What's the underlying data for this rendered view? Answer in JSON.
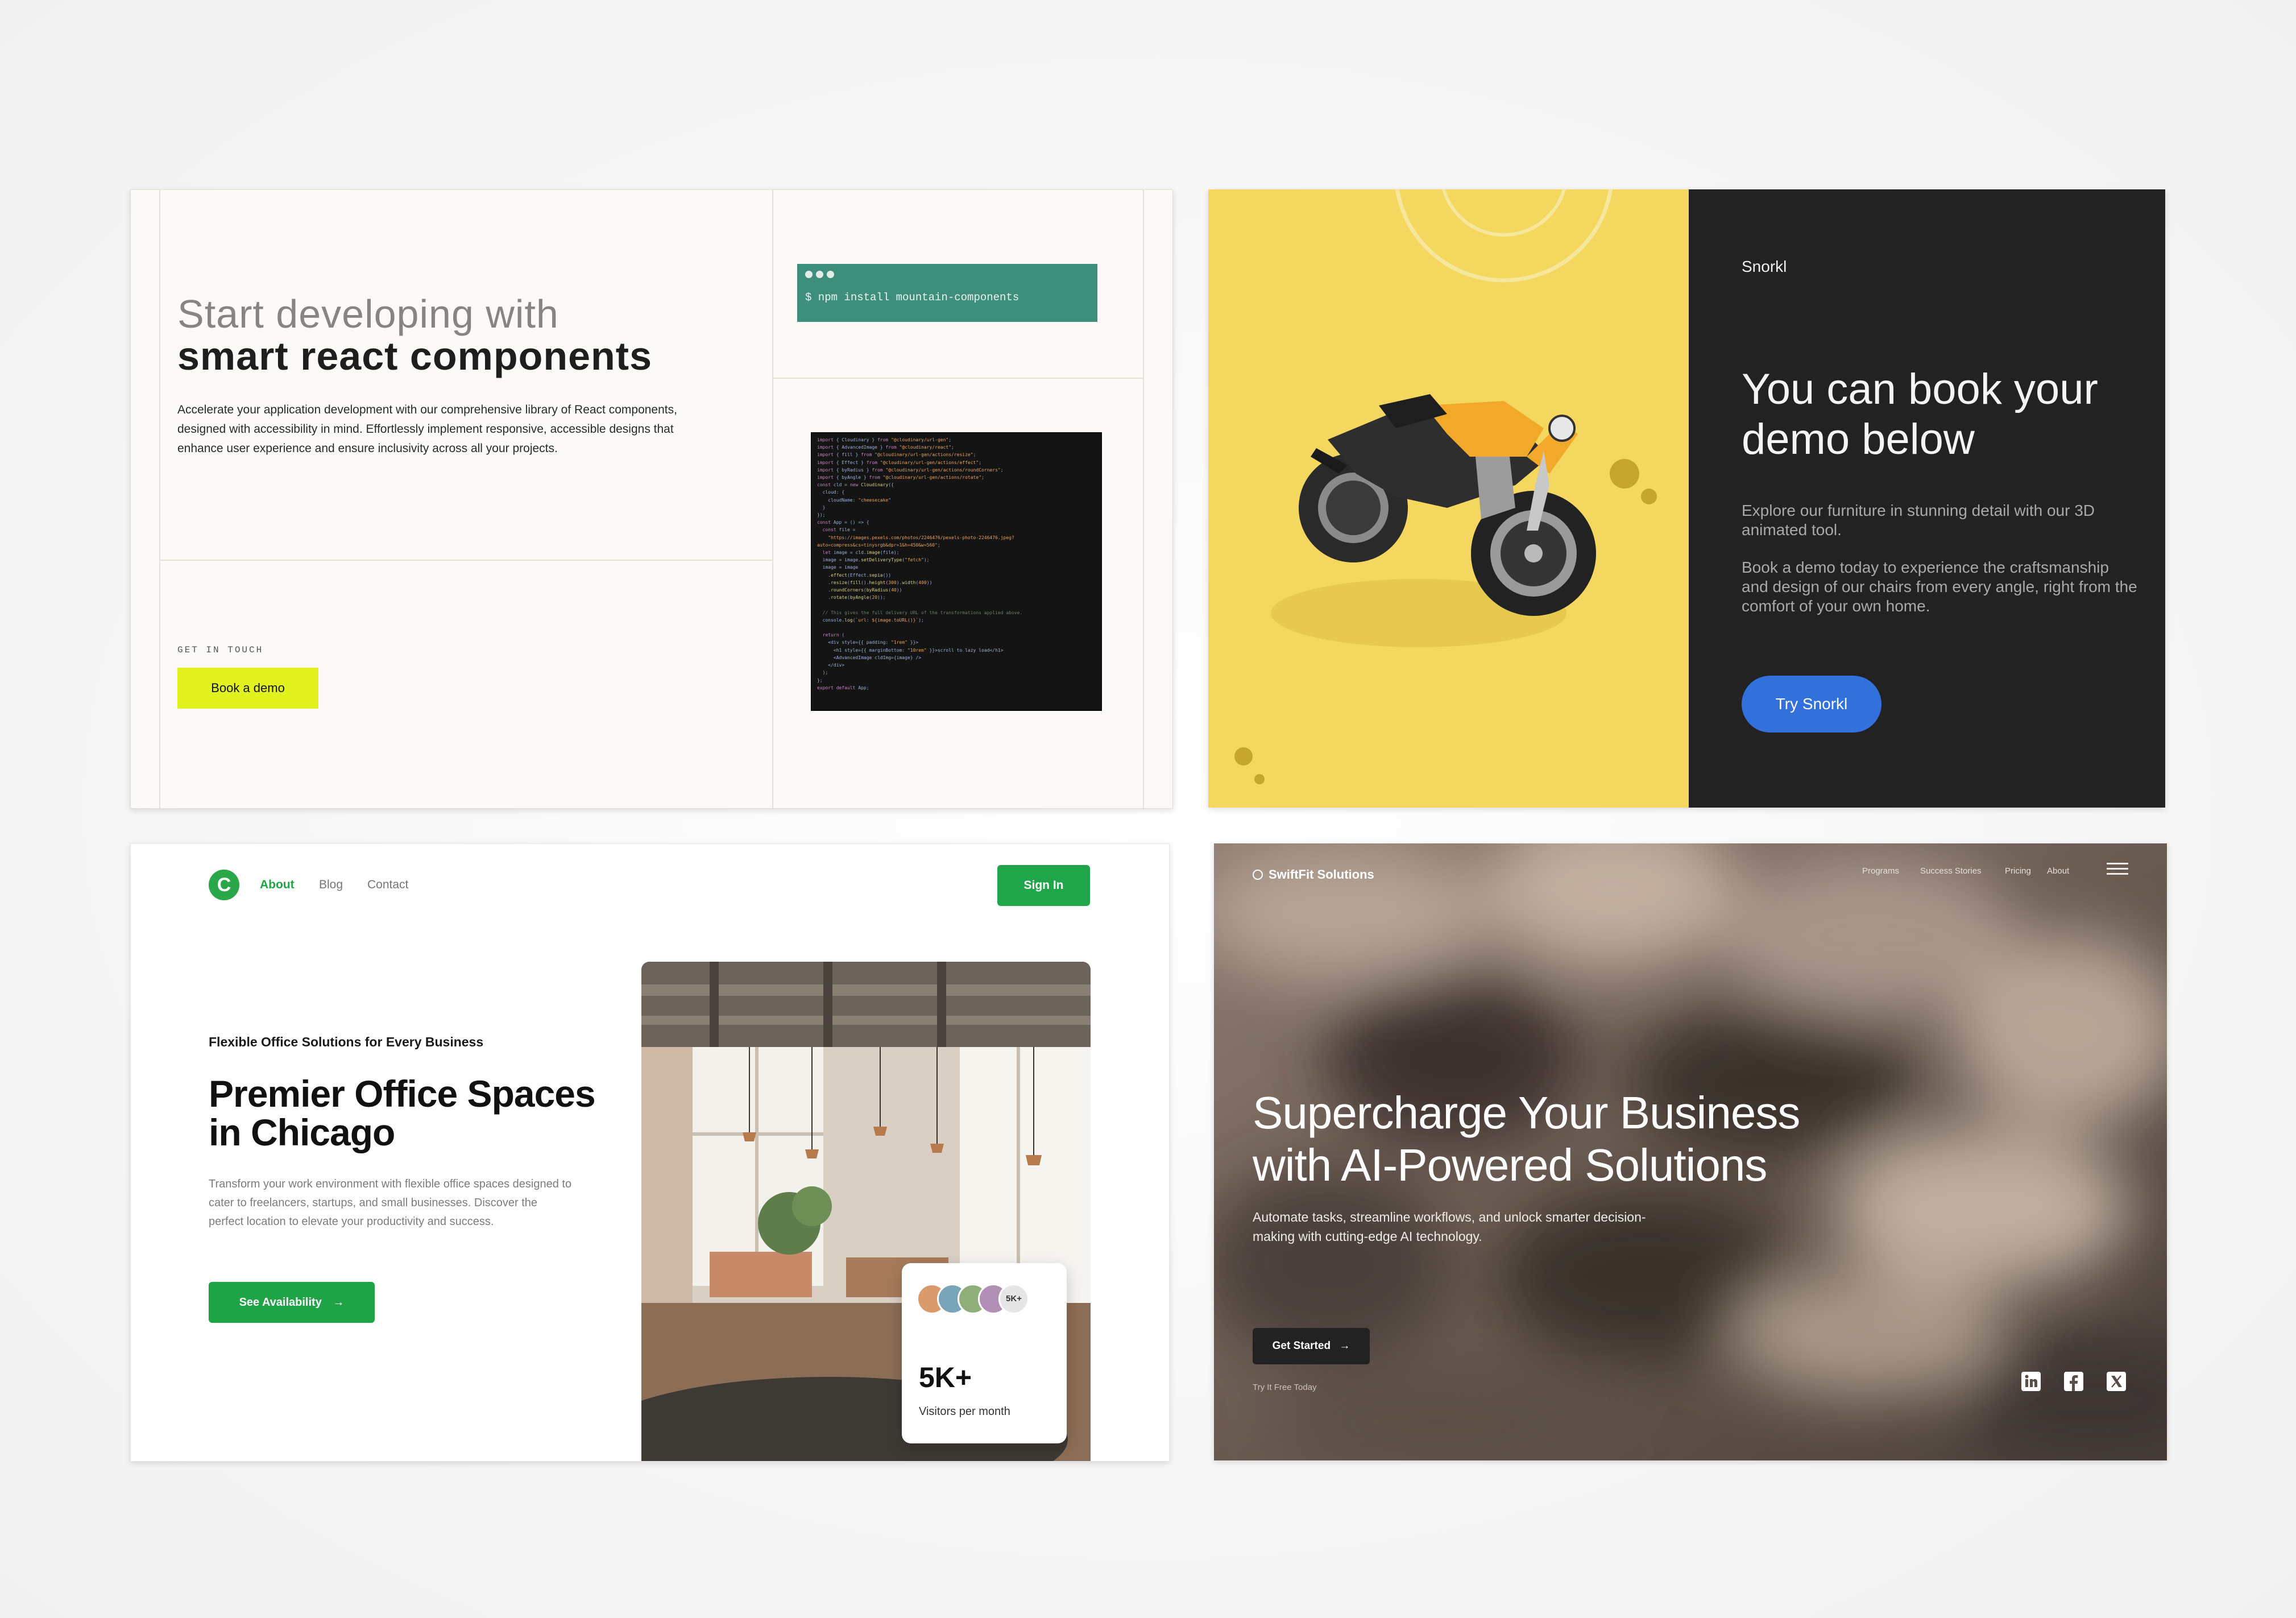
{
  "card1": {
    "heading_light": "Start developing with",
    "heading_bold": "smart react components",
    "paragraph": "Accelerate your application development with our comprehensive library of React components, designed with accessibility in mind. Effortlessly implement responsive, accessible designs that enhance user experience and ensure inclusivity across all your projects.",
    "get_in_touch": "GET IN TOUCH",
    "book_button": "Book a demo",
    "npm_command": "$ npm install mountain-components"
  },
  "card2": {
    "brand": "Snorkl",
    "title": "You can book your demo below",
    "paragraph1": "Explore our furniture in stunning detail with our 3D animated tool.",
    "paragraph2": "Book a demo today to experience the craftsmanship and design of our chairs from every angle, right from the comfort of your own home.",
    "button": "Try Snorkl",
    "colors": {
      "left_panel": "#f4d75e",
      "right_panel": "#222222",
      "button": "#3270dc"
    }
  },
  "card3": {
    "logo_letter": "C",
    "nav": [
      "About",
      "Blog",
      "Contact"
    ],
    "active_nav": "About",
    "sign_in": "Sign In",
    "kicker": "Flexible Office Solutions for Every Business",
    "headline": "Premier Office Spaces in Chicago",
    "description": "Transform your work environment with flexible office spaces designed to cater to freelancers, startups, and small businesses. Discover the perfect location to elevate your productivity and success.",
    "cta": "See Availability",
    "cta_icon": "arrow-right-icon",
    "stat_badge": "5K+",
    "stat_value": "5K+",
    "stat_label": "Visitors per month",
    "colors": {
      "accent": "#20a64a"
    }
  },
  "card4": {
    "brand": "SwiftFit Solutions",
    "nav": [
      "Programs",
      "Success Stories",
      "Pricing",
      "About"
    ],
    "headline": "Supercharge Your Business with AI-Powered Solutions",
    "subtext": "Automate tasks, streamline workflows, and unlock smarter decision-making with cutting-edge AI technology.",
    "cta": "Get Started",
    "cta_icon": "arrow-right-icon",
    "try_free": "Try It Free Today",
    "social": [
      "linkedin-icon",
      "facebook-icon",
      "x-icon"
    ]
  }
}
